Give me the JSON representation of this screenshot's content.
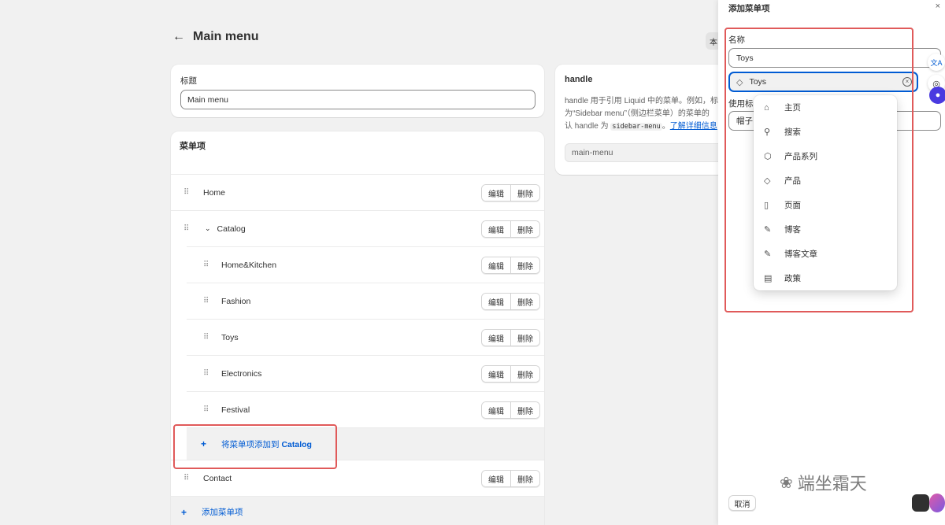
{
  "header": {
    "title": "Main menu",
    "back_icon": "arrow-left-icon",
    "right_button_label": "本"
  },
  "title_card": {
    "label": "标题",
    "value": "Main menu"
  },
  "handle_card": {
    "title": "handle",
    "desc_1": "handle 用于引用 Liquid 中的菜单。例如，标",
    "desc_2": "为“Sidebar menu”（侧边栏菜单）的菜单的",
    "desc_3a": "认 handle 为 ",
    "desc_code": "sidebar-menu",
    "desc_3b": "。",
    "link": "了解详细信息",
    "value": "main-menu"
  },
  "menu_card": {
    "title": "菜单项",
    "edit_label": "编辑",
    "delete_label": "删除",
    "items": [
      {
        "label": "Home"
      },
      {
        "label": "Catalog"
      },
      {
        "label": "Home&Kitchen"
      },
      {
        "label": "Fashion"
      },
      {
        "label": "Toys"
      },
      {
        "label": "Electronics"
      },
      {
        "label": "Festival"
      },
      {
        "label": "Contact"
      }
    ],
    "add_child_prefix": "将菜单项添加到 ",
    "add_child_target": "Catalog",
    "add_root": "添加菜单项",
    "plus": "+"
  },
  "panel": {
    "title": "添加菜单项",
    "close": "×",
    "name_label": "名称",
    "name_value": "Toys",
    "link_value": "Toys",
    "link_icon": "tag-icon",
    "clear": "×",
    "handle_label_partial": "使用标",
    "handle_value_partial": "帽子",
    "cancel": "取消"
  },
  "dropdown": {
    "items": [
      {
        "label": "主页",
        "icon": "home-icon",
        "glyph": "⌂"
      },
      {
        "label": "搜索",
        "icon": "search-icon",
        "glyph": "⚲"
      },
      {
        "label": "产品系列",
        "icon": "collection-tag-icon",
        "glyph": "⬡"
      },
      {
        "label": "产品",
        "icon": "product-tag-icon",
        "glyph": "◇"
      },
      {
        "label": "页面",
        "icon": "page-icon",
        "glyph": "▯"
      },
      {
        "label": "博客",
        "icon": "blog-icon",
        "glyph": "✎"
      },
      {
        "label": "博客文章",
        "icon": "blog-post-icon",
        "glyph": "✎"
      },
      {
        "label": "政策",
        "icon": "policy-icon",
        "glyph": "▤"
      }
    ]
  },
  "side_tools": {
    "translate_glyph": "文A"
  },
  "watermark": {
    "text": "端坐霜天"
  },
  "colors": {
    "accent": "#005bd3",
    "highlight": "#e05a5a",
    "background": "#f1f1f1"
  }
}
